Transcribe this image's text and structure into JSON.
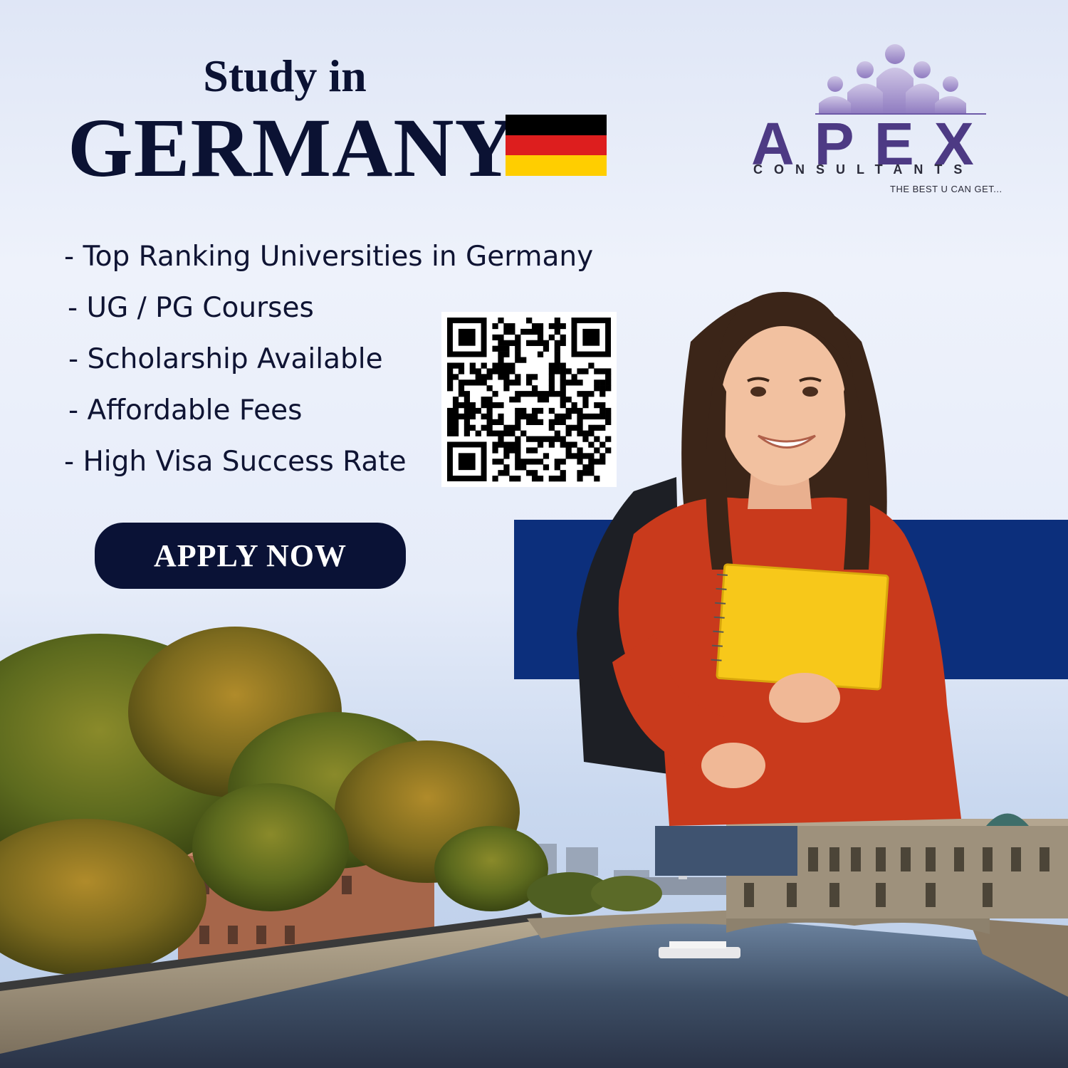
{
  "title": {
    "line1": "Study in",
    "line2": "GERMANY"
  },
  "flag": {
    "colors": [
      "#000000",
      "#dd1e1e",
      "#ffce00"
    ]
  },
  "logo": {
    "word": "APEX",
    "sub": "CONSULTANTS",
    "tagline": "THE BEST U CAN GET...",
    "color": "#4d3a84"
  },
  "features": [
    "- Top Ranking Universities in Germany",
    "- UG / PG Courses",
    "- Scholarship Available",
    "- Affordable Fees",
    "- High Visa Success Rate"
  ],
  "cta": {
    "label": "APPLY NOW"
  },
  "colors": {
    "navy": "#0a1236",
    "band": "#0c2f7c",
    "sweater": "#c93a1c",
    "notebook": "#f7c81a"
  }
}
